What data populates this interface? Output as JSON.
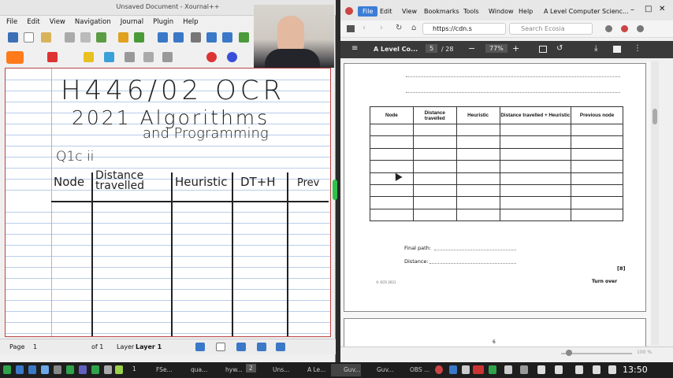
{
  "xournal": {
    "title": "Unsaved Document - Xournal++",
    "menu": [
      "File",
      "Edit",
      "View",
      "Navigation",
      "Journal",
      "Plugin",
      "Help"
    ],
    "status": {
      "page_label": "Page",
      "page_value": "1",
      "of_label": "of 1",
      "layer_label": "Layer",
      "layer_value": "Layer 1"
    },
    "handwriting": {
      "line1": "H446/02   OCR",
      "line2": "2021   Algorithms",
      "line3": "and Programming",
      "line4": "Q1c ii",
      "headers": [
        "Node",
        "Distance travelled",
        "Heuristic",
        "DT+H",
        "Prev"
      ]
    }
  },
  "browser": {
    "tabs": [
      {
        "label": "File",
        "active": true
      },
      {
        "label": "Edit"
      },
      {
        "label": "View"
      },
      {
        "label": "Bookmarks"
      },
      {
        "label": "Tools"
      },
      {
        "label": "Window"
      },
      {
        "label": "Help"
      }
    ],
    "window_title": "A Level Computer Scienc...",
    "url": "https://cdn.s",
    "search_placeholder": "Search Ecosia",
    "pdf": {
      "doc_title": "A Level Co...",
      "page_current": "5",
      "page_total": "/ 28",
      "zoom": "77%",
      "table_headers": [
        "Node",
        "Distance travelled",
        "Heuristic",
        "Distance travelled + Heuristic",
        "Previous node"
      ],
      "final_path_label": "Final path:",
      "distance_label": "Distance:",
      "marks": "[8]",
      "copyright": "© OCR 2021",
      "turn_over": "Turn over",
      "next_page_number": "6"
    },
    "status_zoom": "100 %"
  },
  "taskbar": {
    "items": [
      "FSe...",
      "qua...",
      "hyw...",
      "Uns...",
      "A Le...",
      "Guv...",
      "Guv...",
      "OBS ..."
    ],
    "time": "13:50",
    "workspace": "1",
    "workspace2": "2"
  },
  "colors": {
    "accent": "#3c7dd6",
    "pdf_bar": "#3a3a3a",
    "active_tab": "#3c7dd6"
  }
}
